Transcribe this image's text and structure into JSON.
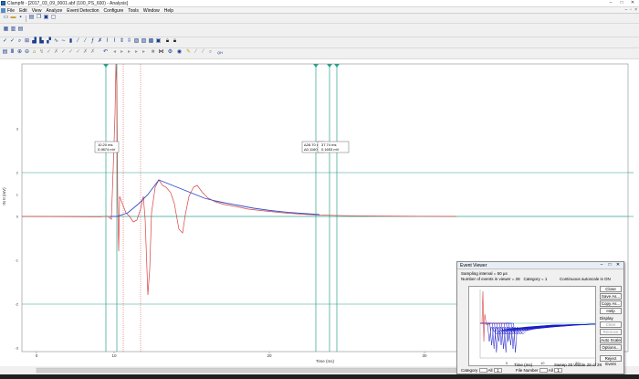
{
  "titlebar": {
    "title": "Clampfit - [2017_03_09_0001.abf (100_PS_600) - Analysis]",
    "btn_min": "–",
    "btn_max": "□",
    "btn_close": "✕"
  },
  "menubar": {
    "items": [
      "File",
      "Edit",
      "View",
      "Analyze",
      "Event Detection",
      "Configure",
      "Tools",
      "Window",
      "Help"
    ],
    "mdi_min": "–",
    "mdi_restore": "▫",
    "mdi_close": "×"
  },
  "plot": {
    "y_axis_label": "IN 0 (mV)",
    "x_axis_label": "Time (ms)",
    "x_ticks": [
      "0",
      "10",
      "20",
      "30",
      "40"
    ],
    "y_ticks": [
      "3",
      "2",
      "1",
      "0",
      "-1",
      "-2",
      "-3"
    ],
    "cursor_box1_line1": "10.20 ms",
    "cursor_box1_line2": "0.9874 mV",
    "cursor_box2_line1": "Δ26.70 ms",
    "cursor_box2_line2": "Δ0.1160 mV",
    "cursor_box3_line1": "37.74 ms",
    "cursor_box3_line2": "0.1653 mV",
    "colors": {
      "trace": "#d94040",
      "fit": "#3050c8",
      "cursor": "#2aa08c",
      "baseline": "#2aa08c"
    }
  },
  "event_viewer": {
    "title": "Event Viewer",
    "sampling": "Sampling interval = 50 µs",
    "events": "Number of events in viewer = 28",
    "category": "Category = 1",
    "autoscale": "Continuous autoscale is ON",
    "x_label": "Time (ms)",
    "x_ticks": [
      "0",
      "10",
      "20"
    ],
    "sweep_info": "Sweep 28  Visible 28 of 28",
    "buttons": {
      "close": "Close",
      "save_as": "Save As...",
      "copy_as": "Copy As...",
      "help": "Help",
      "clear": "Clear",
      "remove": "Remove",
      "auto_scale": "Auto Scale",
      "options": "Options...",
      "reject_event": "Reject Event"
    },
    "display_label": "Display",
    "category_label": "Category",
    "category_all": "All",
    "category_value": "1",
    "file_number_label": "File Number",
    "file_all": "All",
    "file_value": "1",
    "colors": {
      "traces": "#1818c8",
      "first_event": "#d94040"
    }
  }
}
